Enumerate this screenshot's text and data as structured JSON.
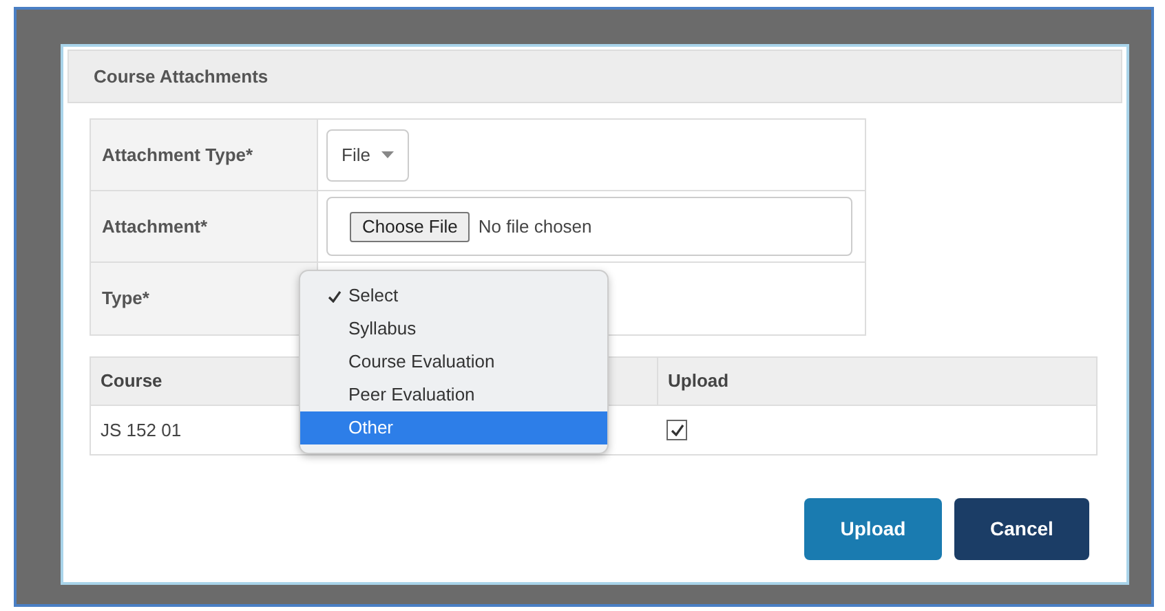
{
  "dialog": {
    "title": "Course Attachments"
  },
  "form": [
    {
      "kind": "select",
      "label": "Attachment Type*",
      "value": "File"
    },
    {
      "kind": "file",
      "label": "Attachment*",
      "button": "Choose File",
      "status": "No file chosen"
    },
    {
      "kind": "covered",
      "label": "Type*"
    }
  ],
  "dropdown": {
    "options": [
      {
        "label": "Select",
        "checked": true,
        "selected": false
      },
      {
        "label": "Syllabus",
        "checked": false,
        "selected": false
      },
      {
        "label": "Course Evaluation",
        "checked": false,
        "selected": false
      },
      {
        "label": "Peer Evaluation",
        "checked": false,
        "selected": false
      },
      {
        "label": "Other",
        "checked": false,
        "selected": true
      }
    ]
  },
  "table": {
    "columns": [
      "Course",
      "Upload"
    ],
    "rows": [
      {
        "course": "JS 152 01",
        "upload": true
      }
    ]
  },
  "buttons": [
    {
      "label": "Upload",
      "kind": "primary"
    },
    {
      "label": "Cancel",
      "kind": "secondary"
    }
  ]
}
